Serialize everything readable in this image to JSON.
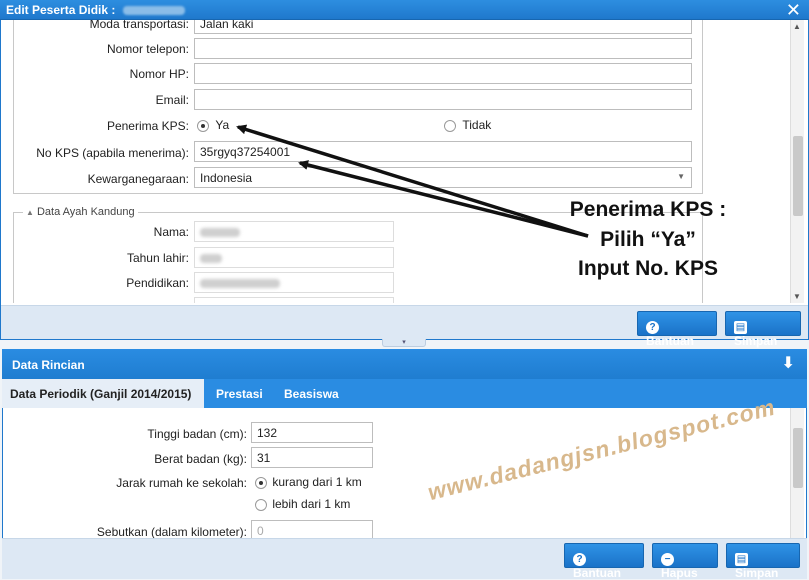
{
  "window": {
    "title": "Edit Peserta Didik :",
    "close_icon": "close-icon"
  },
  "form": {
    "moda": {
      "label": "Moda transportasi:",
      "value": "Jalan kaki"
    },
    "telepon": {
      "label": "Nomor telepon:",
      "value": ""
    },
    "hp": {
      "label": "Nomor HP:",
      "value": ""
    },
    "email": {
      "label": "Email:",
      "value": ""
    },
    "kps": {
      "label": "Penerima KPS:",
      "option_yes": "Ya",
      "option_no": "Tidak",
      "selected": "Ya"
    },
    "no_kps": {
      "label": "No KPS (apabila menerima):",
      "value": "35rgyq37254001"
    },
    "kewarganegaraan": {
      "label": "Kewarganegaraan:",
      "value": "Indonesia"
    }
  },
  "ayah": {
    "legend": "Data Ayah Kandung",
    "nama_label": "Nama:",
    "tahun_label": "Tahun lahir:",
    "pendidikan_label": "Pendidikan:"
  },
  "top_buttons": {
    "bantuan": "Bantuan",
    "simpan": "Simpan"
  },
  "detail": {
    "title": "Data Rincian",
    "tabs": [
      {
        "label": "Data Periodik (Ganjil 2014/2015)",
        "active": true
      },
      {
        "label": "Prestasi",
        "active": false
      },
      {
        "label": "Beasiswa",
        "active": false
      }
    ],
    "tinggi": {
      "label": "Tinggi badan (cm):",
      "value": "132"
    },
    "berat": {
      "label": "Berat badan (kg):",
      "value": "31"
    },
    "jarak": {
      "label": "Jarak rumah ke sekolah:",
      "option1": "kurang dari 1 km",
      "option2": "lebih dari 1 km",
      "selected": "kurang dari 1 km"
    },
    "sebutkan": {
      "label": "Sebutkan (dalam kilometer):",
      "value": "0"
    }
  },
  "bottom_buttons": {
    "bantuan": "Bantuan",
    "hapus": "Hapus",
    "simpan": "Simpan"
  },
  "annotation": {
    "line1": "Penerima KPS :",
    "line2": "Pilih “Ya”",
    "line3": "Input No. KPS"
  },
  "watermark": "www.dadangjsn.blogspot.com"
}
